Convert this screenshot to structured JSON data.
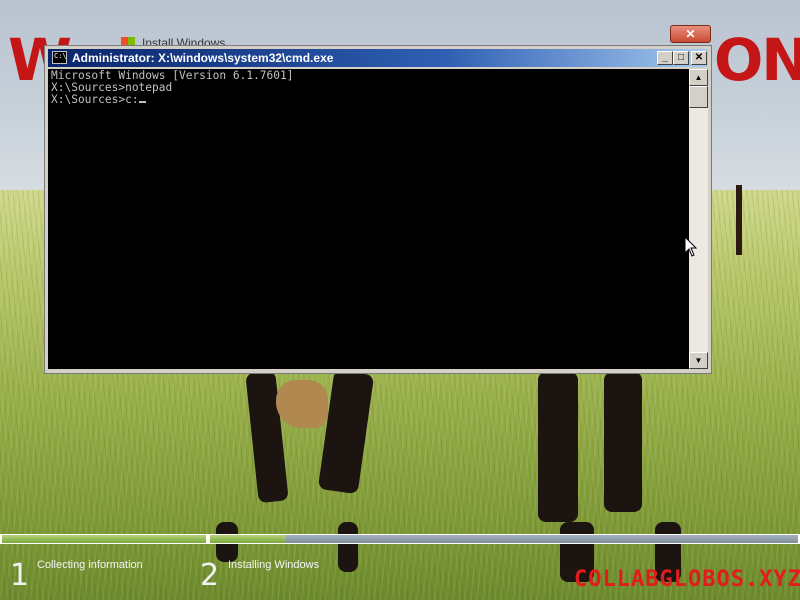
{
  "background": {
    "install_window_title": "Install Windows",
    "install_close_glyph": "✕",
    "brand_left": "W",
    "brand_right": "ON"
  },
  "cmd_window": {
    "title": "Administrator: X:\\windows\\system32\\cmd.exe",
    "icon": "cmd-icon",
    "buttons": {
      "minimize": "_",
      "maximize": "□",
      "close": "✕"
    },
    "scroll_up": "▲",
    "scroll_down": "▼",
    "console_lines": [
      "Microsoft Windows [Version 6.1.7601]",
      "",
      "X:\\Sources>notepad",
      "",
      "X:\\Sources>c:"
    ]
  },
  "install_progress": {
    "steps": [
      {
        "number": "1",
        "label": "Collecting information",
        "progress": 1.0
      },
      {
        "number": "2",
        "label": "Installing Windows",
        "progress": 0.13
      }
    ]
  },
  "watermark": "COLLABGLOBOS.XYZ",
  "colors": {
    "progress_done": "#8db34a",
    "progress_remaining": "#8796a4",
    "brand_red": "#c41616"
  }
}
